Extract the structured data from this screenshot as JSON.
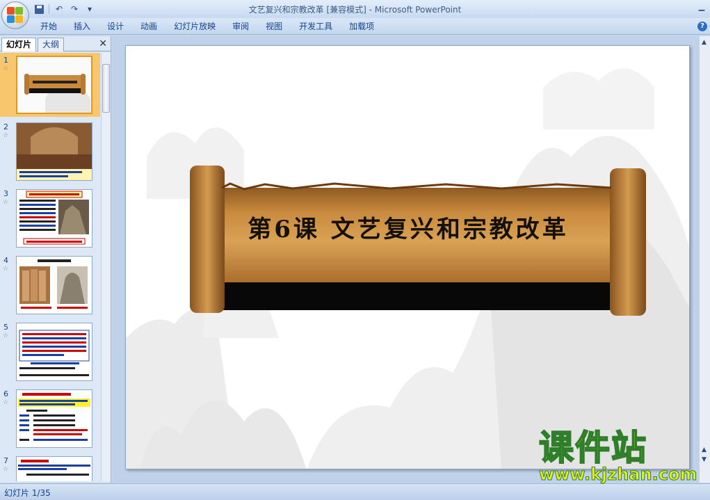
{
  "window": {
    "title": "文艺复兴和宗教改革 [兼容模式] - Microsoft PowerPoint"
  },
  "ribbon": {
    "tabs": [
      "开始",
      "插入",
      "设计",
      "动画",
      "幻灯片放映",
      "审阅",
      "视图",
      "开发工具",
      "加载项"
    ]
  },
  "left_pane": {
    "tab_slides": "幻灯片",
    "tab_outline": "大纲",
    "thumbnails": [
      {
        "num": "1",
        "selected": true
      },
      {
        "num": "2",
        "selected": false
      },
      {
        "num": "3",
        "selected": false
      },
      {
        "num": "4",
        "selected": false
      },
      {
        "num": "5",
        "selected": false
      },
      {
        "num": "6",
        "selected": false
      },
      {
        "num": "7",
        "selected": false
      }
    ]
  },
  "slide": {
    "title": "第6课  文艺复兴和宗教改革"
  },
  "status": {
    "slide_indicator": "幻灯片 1/35"
  },
  "watermark": {
    "name": "课件站",
    "url": "www.kjzhan.com"
  },
  "icons": [
    "office-button-icon",
    "save-icon",
    "undo-icon",
    "redo-icon",
    "customize-icon",
    "minimize-icon",
    "help-icon",
    "close-pane-icon",
    "star-icon"
  ],
  "colors": {
    "selected_thumb": "#f8c66d",
    "ribbon_text": "#15428b",
    "scroll_paper": "#c98a3e"
  }
}
